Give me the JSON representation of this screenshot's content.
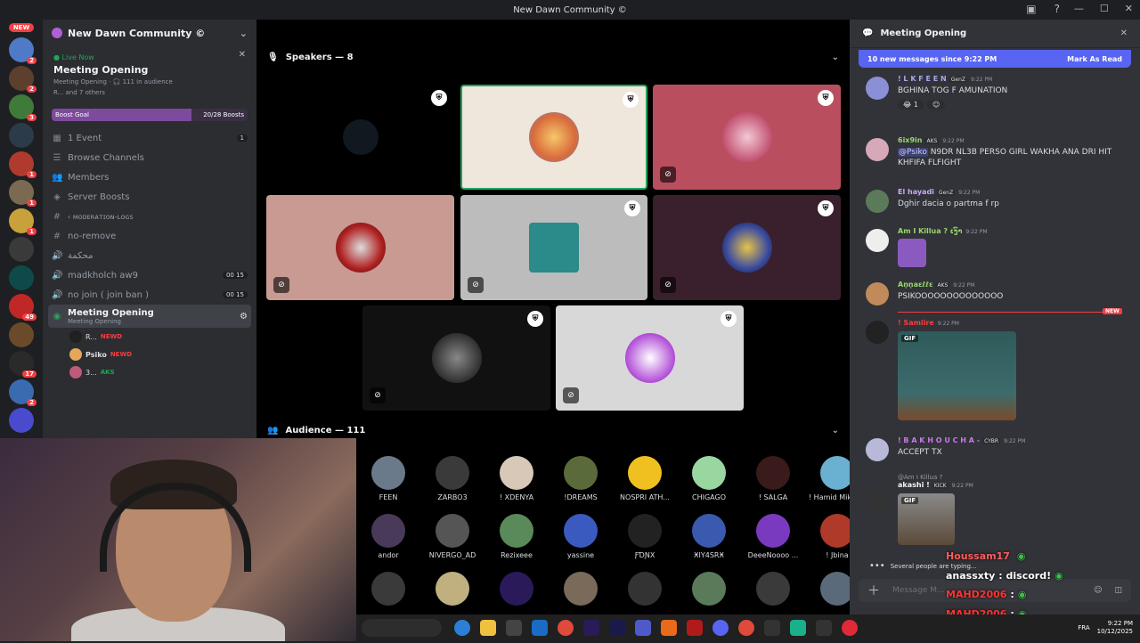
{
  "window": {
    "title": "New Dawn Community ©"
  },
  "servers": {
    "new_badge": "NEW",
    "badges": [
      "2",
      "2",
      "3",
      "",
      "1",
      "1",
      "1",
      "",
      "49",
      "",
      "17",
      "2",
      "",
      ""
    ]
  },
  "guild": {
    "name": "New Dawn Community ©"
  },
  "live": {
    "status": "Live Now",
    "title": "Meeting Opening",
    "meta": "Meeting Opening · 🎧 111 in audience",
    "members": "R... and 7 others"
  },
  "boost": {
    "label": "Boost Goal",
    "progress": "20/28 Boosts",
    "fraction": 0.714
  },
  "channels": [
    {
      "icon": "calendar",
      "label": "1 Event",
      "count": "1"
    },
    {
      "icon": "browse",
      "label": "Browse Channels",
      "count": ""
    },
    {
      "icon": "members",
      "label": "Members",
      "count": ""
    },
    {
      "icon": "boost",
      "label": "Server Boosts",
      "count": ""
    },
    {
      "icon": "hash",
      "label": "‹ ᴍᴏᴅᴇʀᴀᴛɪᴏɴ-ʟᴏɢꜱ",
      "count": ""
    },
    {
      "icon": "hash",
      "label": "no-remove",
      "count": ""
    },
    {
      "icon": "speaker",
      "label": "محكمة",
      "count": ""
    },
    {
      "icon": "speaker",
      "label": "madkholch aw9",
      "count": "00 15"
    },
    {
      "icon": "speaker",
      "label": "no join ( join ban )",
      "count": "00 15"
    }
  ],
  "active_channel": {
    "label": "Meeting Opening",
    "sub": "Meeting Opening"
  },
  "voice_users": [
    {
      "name": "R...",
      "tag": "NEWD"
    },
    {
      "name": "Psiko",
      "tag": "NEWD"
    },
    {
      "name": "3...",
      "tag": "AKS"
    }
  ],
  "stage": {
    "speakers_label": "Speakers — 8",
    "audience_label": "Audience — 111"
  },
  "audience": [
    "FEEN",
    "ZARBO3",
    "! XDENYA",
    "!DREAMS",
    "NOSPRI ATH...",
    "CHIGAGO",
    "! SALGA",
    "! Hamid Mikwak",
    "andor",
    "NIVERGO_AD",
    "Rezixeee",
    "yassine",
    "ƑƊƝX",
    "ӾIY4SRӾ",
    "DeeeNoooo ...",
    "! Jbina",
    "",
    "",
    "",
    "",
    "",
    "",
    "",
    ""
  ],
  "chat": {
    "title": "Meeting Opening",
    "new_messages": "10 new messages since 9:22 PM",
    "mark_read": "Mark As Read",
    "messages": [
      {
        "name": "! L K F E E N",
        "tag": "GenZ",
        "time": "9:22 PM",
        "text": "BGHINA TOG F AMUNATION",
        "color": "#a6a9ef",
        "react": "1"
      },
      {
        "name": "6ix9in",
        "tag": "AKS",
        "time": "9:22 PM",
        "mention": "@Psiko",
        "text": "N9DR NL3B PERSO GIRL WAKHA ANA DRI HIT KHFIFA FLFIGHT",
        "color": "#9bd46f"
      },
      {
        "name": "El hayadi",
        "tag": "GenZ",
        "time": "9:22 PM",
        "text": "Dghir dacia o partma f rp",
        "color": "#c9a9f3"
      },
      {
        "name": "Am I Killua ? ເງົາ",
        "tag": "",
        "time": "9:22 PM",
        "text": "",
        "color": "#9bd46f"
      },
      {
        "name": "Aṇṇaɛℓℓɛ",
        "tag": "AKS",
        "time": "9:22 PM",
        "text": "PSIKOOOOOOOOOOOOOO",
        "color": "#9bd46f"
      },
      {
        "name": "! Samiire",
        "tag": "",
        "time": "9:22 PM",
        "text": "",
        "color": "#f23f43",
        "gif": "GIF"
      },
      {
        "name": "! B A K H O U C H A -",
        "tag": "CYBR",
        "time": "9:22 PM",
        "text": "ACCEPT TX",
        "color": "#c879e6"
      },
      {
        "name": "akashi !",
        "tag": "KICK",
        "time": "9:22 PM",
        "reply": "@Am I Killua ?",
        "text": "",
        "color": "#f2f3f5",
        "gif": "GIF"
      }
    ],
    "new_tag": "NEW",
    "typing": "Several people are typing...",
    "composer_placeholder": "Message M..."
  },
  "overlay_chat": [
    {
      "user": "Houssam17",
      "text": "",
      "color": "#ff5c5c"
    },
    {
      "user": "anassxty",
      "text": ": discord!",
      "color": "#ffffff"
    },
    {
      "user": "MAHD2006",
      "text": ":",
      "color": "#ff3333"
    },
    {
      "user": "MAHD2006",
      "text": ":",
      "color": "#ff3333"
    },
    {
      "user": "MAHD2006",
      "text": ":",
      "color": "#ff3333"
    }
  ],
  "taskbar": {
    "lang": "FRA",
    "time": "9:22 PM",
    "date": "10/12/2025"
  },
  "colors": {
    "accent": "#5865f2",
    "danger": "#f23f43",
    "online": "#23a55a"
  }
}
